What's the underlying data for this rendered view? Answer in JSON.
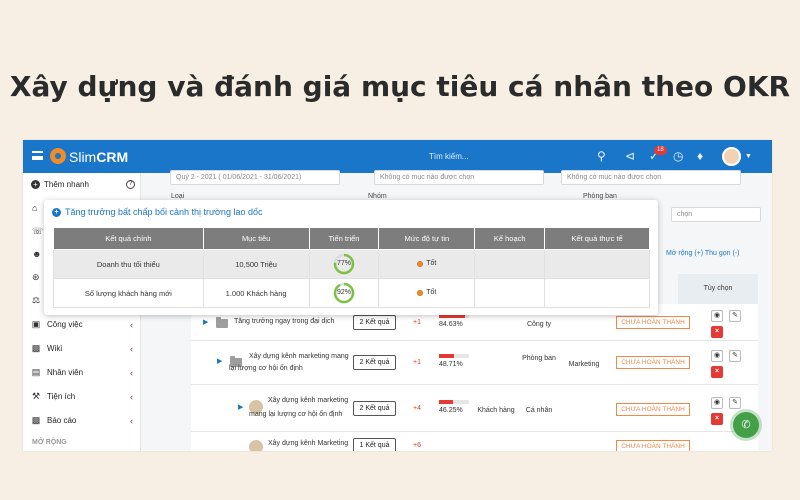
{
  "headline": "Xây dựng và đánh giá mục tiêu cá nhân theo OKR",
  "topbar": {
    "logo_prefix": "Slim",
    "logo_suffix": "CRM",
    "search_placeholder": "Tìm kiếm...",
    "notification_count": "18"
  },
  "sidebar": {
    "quick_add": "Thêm nhanh",
    "items": [
      {
        "label": "Công việc",
        "icon": "briefcase-icon"
      },
      {
        "label": "Wiki",
        "icon": "wiki-icon"
      },
      {
        "label": "Nhân viên",
        "icon": "employee-icon"
      },
      {
        "label": "Tiện ích",
        "icon": "wrench-icon"
      },
      {
        "label": "Báo cáo",
        "icon": "chart-icon"
      }
    ],
    "section": "MỞ RỘNG"
  },
  "filters": {
    "period_value": "Quý 2 - 2021 ( 01/06/2021 - 31/06/2021)",
    "type_label": "Loại",
    "type_placeholder": "Không có mục nào được chọn",
    "group_label": "Nhóm",
    "group_placeholder": "Không có mục nào được chọn",
    "department_label": "Phòng ban",
    "department_value": "chọn"
  },
  "expand_links": "Mở rộng (+) Thu gọn (-)",
  "grid": {
    "options_header": "Tùy chọn",
    "rows": [
      {
        "name_line1": "Tăng trưởng ngay trong đại dịch",
        "name_line2": "",
        "result": "2 Kết quả",
        "delta": "+1",
        "progress": 84.63,
        "progress_label": "84.63%",
        "audience": "",
        "scope": "Công ty",
        "department": "",
        "status": "CHƯA HOÀN THÀNH"
      },
      {
        "name_line1": "Xây dựng kênh marketing mang",
        "name_line2": "lại lượng cơ hội ổn định",
        "result": "2 Kết quả",
        "delta": "+1",
        "progress": 48.71,
        "progress_label": "48.71%",
        "audience": "",
        "scope": "Phòng ban",
        "department": "Marketing",
        "status": "CHƯA HOÀN THÀNH"
      },
      {
        "name_line1": "Xây dựng kênh marketing",
        "name_line2": "mang lại lượng cơ hội ổn định",
        "result": "2 Kết quả",
        "delta": "+4",
        "progress": 46.25,
        "progress_label": "46.25%",
        "audience": "Khách hàng",
        "scope": "Cá nhân",
        "department": "",
        "status": "CHƯA HOÀN THÀNH"
      },
      {
        "name_line1": "Xây dựng kênh Marketing",
        "name_line2": "",
        "result": "1 Kết quả",
        "delta": "+6",
        "progress": 0,
        "progress_label": "",
        "audience": "",
        "scope": "",
        "department": "",
        "status": "CHƯA HOÀN THÀNH"
      }
    ]
  },
  "popup": {
    "title": "Tăng trưởng bất chấp bối cảnh thị trường lao dốc",
    "headers": [
      "Kết quả chính",
      "Mục tiêu",
      "Tiến triển",
      "Mức độ tự tin",
      "Kế hoạch",
      "Kết quả thực tế"
    ],
    "rows": [
      {
        "key_result": "Doanh thu tối thiểu",
        "target": "10,500 Triệu",
        "progress": 77,
        "progress_label": "77%",
        "confidence": "Tốt",
        "plan": "",
        "actual": ""
      },
      {
        "key_result": "Số lượng khách hàng mới",
        "target": "1.000 Khách hàng",
        "progress": 92,
        "progress_label": "92%",
        "confidence": "Tốt",
        "plan": "",
        "actual": ""
      }
    ]
  },
  "colors": {
    "primary": "#1976c9",
    "accent": "#f28c28",
    "progress": "#7cc242",
    "danger": "#e53935",
    "status": "#f08a4b"
  }
}
